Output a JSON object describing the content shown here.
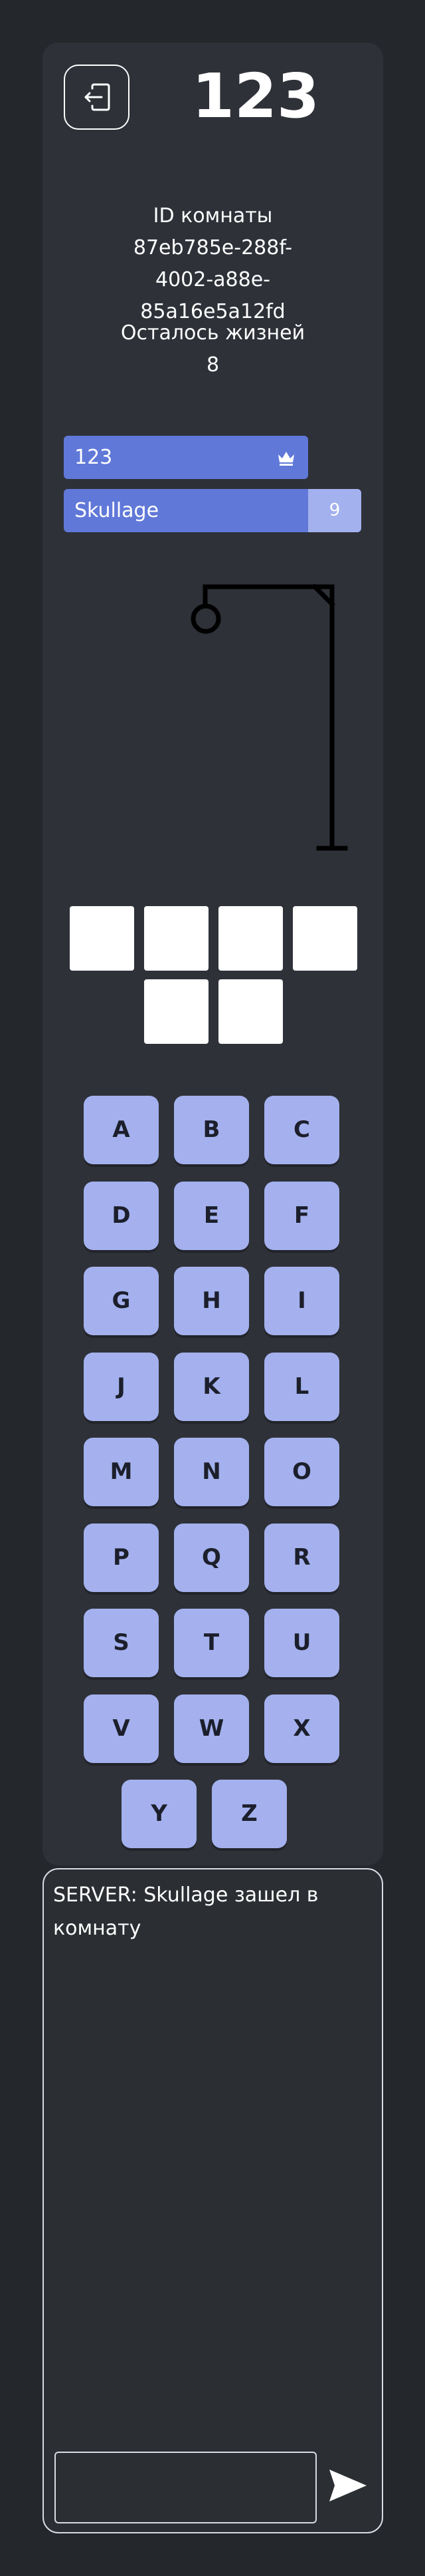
{
  "room": {
    "title": "123",
    "id_label": "ID комнаты",
    "id_value": "87eb785e-288f-4002-a88e-85a16e5a12fd",
    "lives_label": "Осталось жизней",
    "lives_value": "8"
  },
  "players": [
    {
      "name": "123",
      "is_host": true
    },
    {
      "name": "Skullage",
      "score": "9"
    }
  ],
  "word_tiles_count": 6,
  "keyboard": [
    "A",
    "B",
    "C",
    "D",
    "E",
    "F",
    "G",
    "H",
    "I",
    "J",
    "K",
    "L",
    "M",
    "N",
    "O",
    "P",
    "Q",
    "R",
    "S",
    "T",
    "U",
    "V",
    "W",
    "X",
    "Y",
    "Z"
  ],
  "chat": {
    "messages": [
      "SERVER: Skullage зашел в комнату"
    ],
    "input_value": ""
  },
  "colors": {
    "background": "#24272b",
    "panel": "#2e3138",
    "player_bar": "#6078d8",
    "player_score": "#a3b1ee",
    "key": "#a4b1ee",
    "tile": "#ffffff"
  },
  "icons": {
    "exit": "door-exit-icon",
    "host": "crown-icon",
    "send": "send-arrow-icon"
  }
}
